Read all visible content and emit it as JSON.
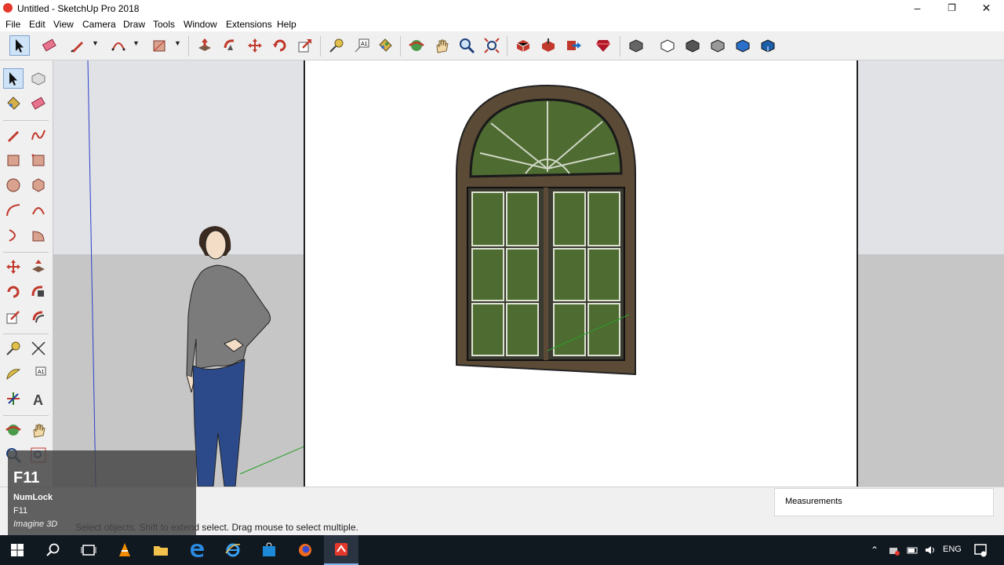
{
  "window": {
    "title": "Untitled - SketchUp Pro 2018",
    "min_glyph": "–",
    "max_glyph": "❐",
    "close_glyph": "✕"
  },
  "menu": [
    "File",
    "Edit",
    "View",
    "Camera",
    "Draw",
    "Tools",
    "Window",
    "Extensions",
    "Help"
  ],
  "status": {
    "hint": "Select objects. Shift to extend select. Drag mouse to select multiple.",
    "measurements_label": "Measurements"
  },
  "keystroke_overlay": {
    "key": "F11",
    "line1": "NumLock",
    "line2": "F11",
    "brand": "Imagine 3D"
  },
  "taskbar": {
    "lang": "ENG"
  },
  "colors": {
    "accent_red": "#e5372b",
    "glass": "#4e6b31",
    "frame": "#5a4a36",
    "taskbar": "#101820"
  }
}
